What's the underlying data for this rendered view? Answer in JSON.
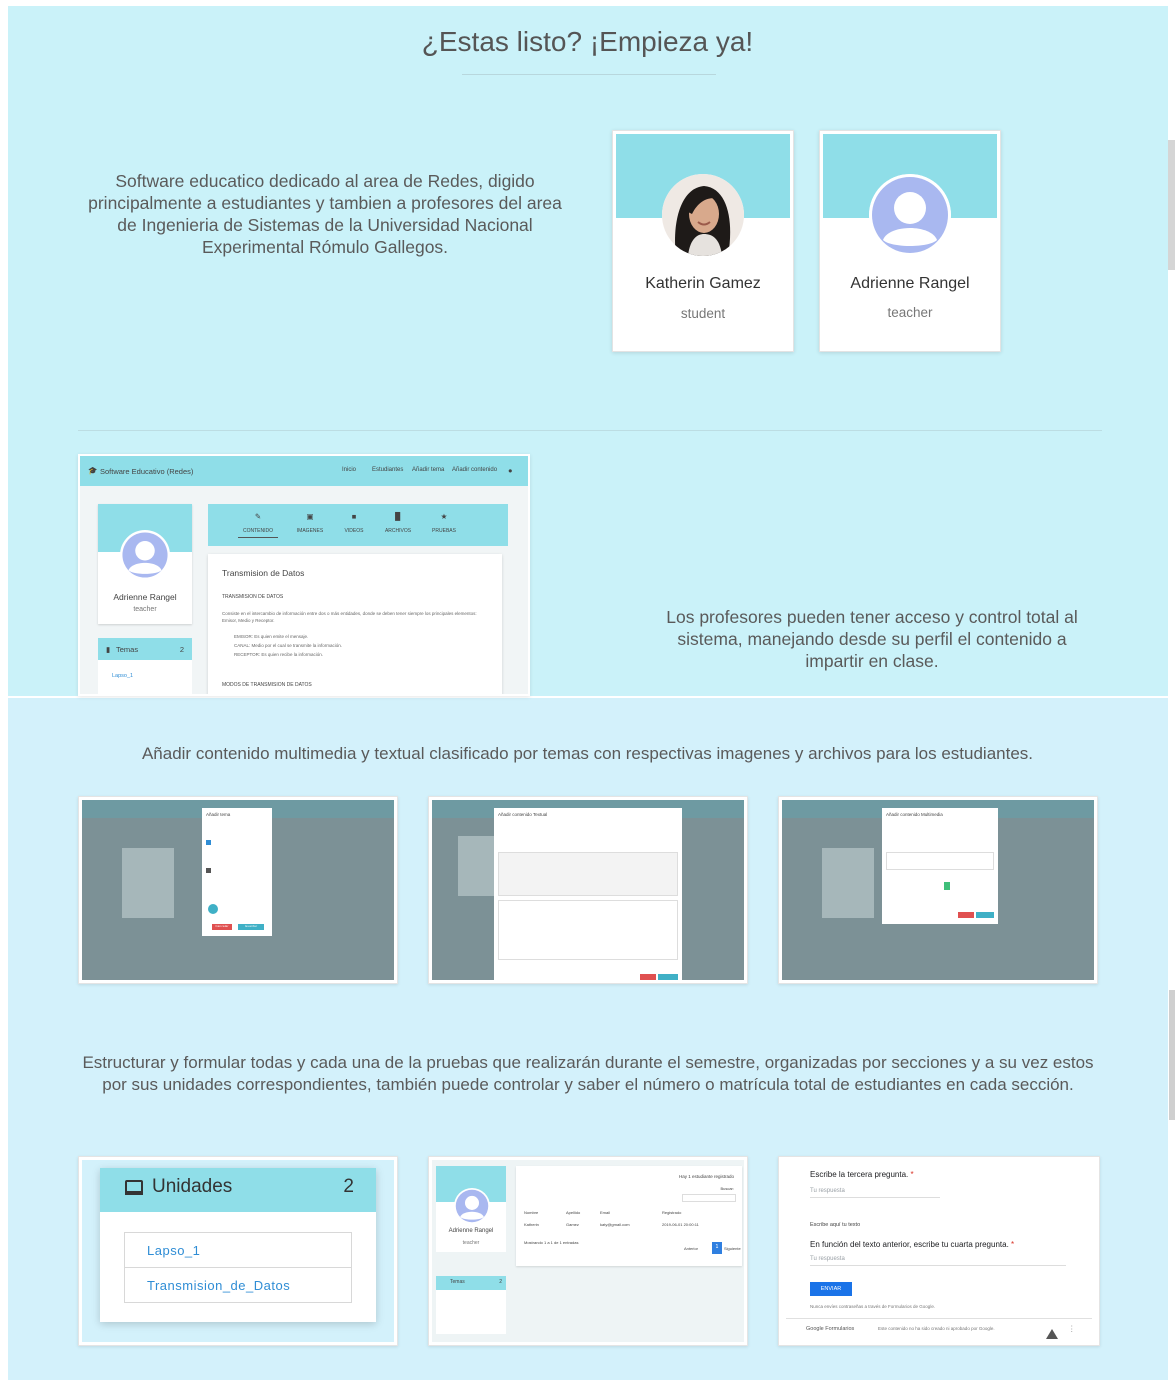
{
  "headline": "¿Estas listo? ¡Empieza ya!",
  "intro": "Software educatico dedicado al area de Redes, digido principalmente a estudiantes y tambien a profesores del area de Ingenieria de Sistemas de la Universidad Nacional Experimental Rómulo Gallegos.",
  "profiles": [
    {
      "name": "Katherin Gamez",
      "role": "student"
    },
    {
      "name": "Adrienne Rangel",
      "role": "teacher"
    }
  ],
  "teacher_text": "Los profesores pueden tener acceso y control total al sistema, manejando desde su perfil el contenido a impartir en clase.",
  "mock": {
    "brand": "Software Educativo (Redes)",
    "nav": [
      "Inicio",
      "Estudiantes",
      "Añadir tema",
      "Añadir contenido"
    ],
    "profile_name": "Adrienne Rangel",
    "profile_role": "teacher",
    "temas_label": "Temas",
    "temas_count": "2",
    "temas_item": "Lapso_1",
    "tabs": [
      "CONTENIDO",
      "IMAGENES",
      "VIDEOS",
      "ARCHIVOS",
      "PRUEBAS"
    ],
    "content_title": "Transmision de Datos",
    "content_heading": "TRANSMISION DE DATOS",
    "content_para": "Consiste en el intercambio de información entre dos o más entidades, donde se deben tener siempre los principales elementos: Emisor, Medio y Receptor.",
    "bullets": [
      "EMISOR: Es quien emite el mensaje.",
      "CANAL: Medio por el cual se transmite la información.",
      "RECEPTOR: Es quien recibe la información."
    ],
    "content_sub": "MODOS DE TRANSMISION DE DATOS"
  },
  "multi_text": "Añadir contenido multimedia y textual clasificado por temas con respectivas imagenes y archivos para los estudiantes.",
  "modals": [
    {
      "title": "Añadir tema"
    },
    {
      "title": "Añadir contenido Textual"
    },
    {
      "title": "Añadir contenido Multimedia"
    }
  ],
  "modal_buttons": {
    "cancel": "Cancelar",
    "save": "Guardar"
  },
  "test_text": "Estructurar y formular todas y cada una de la pruebas que realizarán durante el semestre, organizadas por secciones y a su vez estos por sus unidades correspondientes, también puede controlar y saber el número o matrícula total de estudiantes en cada sección.",
  "units": {
    "title": "Unidades",
    "count": "2",
    "items": [
      "Lapso_1",
      "Transmision_de_Datos"
    ]
  },
  "students_shot": {
    "profile_name": "Adrienne Rangel",
    "profile_role": "teacher",
    "badge": "Hay 1 estudiante registrado",
    "temas_label": "Temas",
    "temas_count": "2",
    "search_label": "Buscar:",
    "columns": [
      "Nombre",
      "Apellido",
      "Email",
      "Registrado"
    ],
    "row": [
      "1",
      "Katherin",
      "Gamez",
      "katy@gmail.com",
      "2019-06-01 20:00:11"
    ],
    "footer": "Mostrando 1 a 1 de 1 entradas",
    "prev": "Anterior",
    "page": "1",
    "next": "Siguiente"
  },
  "form_shot": {
    "q3": "Escribe la tercera pregunta.",
    "answer_placeholder": "Tu respuesta",
    "text_label": "Escribe aquí tu texto",
    "q4": "En función del texto anterior, escribe tu cuarta pregunta.",
    "submit": "ENVIAR",
    "notice": "Nunca envíes contraseñas a través de Formularios de Google.",
    "brand": "Google Formularios",
    "disclaimer": "Este contenido no ha sido creado ni aprobado por Google."
  },
  "colors": {
    "section_top": "#caf2f9",
    "section_bottom": "#d3f1fb",
    "accent": "#8fdee8",
    "link": "#2f8dd5",
    "avatar": "#a9b8f0"
  }
}
